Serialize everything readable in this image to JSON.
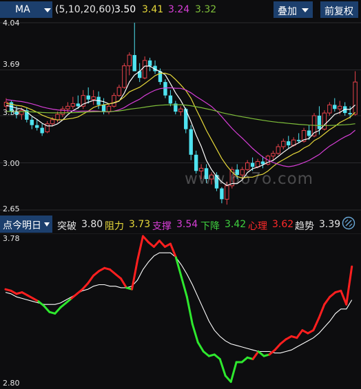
{
  "top": {
    "indicator": "MA",
    "params": "(5,10,20,60)",
    "ma5": "3.50",
    "ma10": "3.41",
    "ma20": "3.24",
    "ma60": "3.32",
    "overlay": "叠加",
    "adjust": "前复权"
  },
  "main_axis": {
    "y1": "4.04",
    "y2": "3.69",
    "y3": "3.35",
    "y4": "3.00",
    "y5": "2.65"
  },
  "watermark": "www.6o7o.com",
  "colors": {
    "up": "#e8434b",
    "down": "#4fe3f0",
    "ma5": "#ffffff",
    "ma10": "#e6d83a",
    "ma20": "#d63ed6",
    "ma60": "#7fbf3a"
  },
  "chart_data": [
    {
      "type": "candlestick",
      "ylim": [
        2.65,
        4.04
      ],
      "ticks": [
        4.04,
        3.69,
        3.35,
        3.0,
        2.65
      ],
      "candles": [
        [
          3.42,
          3.48,
          3.38,
          3.45
        ],
        [
          3.45,
          3.46,
          3.36,
          3.38
        ],
        [
          3.38,
          3.42,
          3.33,
          3.36
        ],
        [
          3.36,
          3.41,
          3.32,
          3.39
        ],
        [
          3.39,
          3.41,
          3.3,
          3.32
        ],
        [
          3.32,
          3.34,
          3.25,
          3.28
        ],
        [
          3.28,
          3.32,
          3.24,
          3.26
        ],
        [
          3.26,
          3.29,
          3.2,
          3.22
        ],
        [
          3.23,
          3.31,
          3.22,
          3.29
        ],
        [
          3.29,
          3.34,
          3.27,
          3.32
        ],
        [
          3.32,
          3.38,
          3.3,
          3.36
        ],
        [
          3.36,
          3.42,
          3.34,
          3.4
        ],
        [
          3.4,
          3.45,
          3.37,
          3.42
        ],
        [
          3.42,
          3.49,
          3.4,
          3.44
        ],
        [
          3.44,
          3.5,
          3.4,
          3.42
        ],
        [
          3.42,
          3.54,
          3.4,
          3.5
        ],
        [
          3.5,
          3.56,
          3.44,
          3.47
        ],
        [
          3.47,
          3.54,
          3.43,
          3.49
        ],
        [
          3.49,
          3.53,
          3.4,
          3.43
        ],
        [
          3.43,
          3.48,
          3.36,
          3.38
        ],
        [
          3.38,
          3.44,
          3.36,
          3.42
        ],
        [
          3.42,
          3.52,
          3.41,
          3.5
        ],
        [
          3.5,
          3.58,
          3.49,
          3.56
        ],
        [
          3.56,
          3.74,
          3.55,
          3.72
        ],
        [
          3.72,
          3.82,
          3.65,
          3.8
        ],
        [
          3.8,
          4.04,
          3.74,
          3.68
        ],
        [
          3.68,
          3.74,
          3.6,
          3.63
        ],
        [
          3.63,
          3.79,
          3.62,
          3.76
        ],
        [
          3.76,
          3.78,
          3.68,
          3.72
        ],
        [
          3.72,
          3.76,
          3.66,
          3.68
        ],
        [
          3.68,
          3.7,
          3.58,
          3.6
        ],
        [
          3.6,
          3.62,
          3.48,
          3.5
        ],
        [
          3.5,
          3.54,
          3.42,
          3.44
        ],
        [
          3.44,
          3.46,
          3.36,
          3.38
        ],
        [
          3.38,
          3.42,
          3.35,
          3.4
        ],
        [
          3.4,
          3.41,
          3.22,
          3.25
        ],
        [
          3.25,
          3.28,
          3.02,
          3.06
        ],
        [
          3.06,
          3.09,
          2.92,
          2.94
        ],
        [
          2.94,
          2.99,
          2.88,
          2.96
        ],
        [
          2.96,
          2.99,
          2.85,
          2.88
        ],
        [
          2.88,
          2.93,
          2.84,
          2.91
        ],
        [
          2.91,
          2.93,
          2.79,
          2.81
        ],
        [
          2.81,
          2.82,
          2.7,
          2.73
        ],
        [
          2.73,
          2.86,
          2.69,
          2.83
        ],
        [
          2.83,
          2.97,
          2.81,
          2.95
        ],
        [
          2.95,
          2.99,
          2.88,
          2.91
        ],
        [
          2.91,
          2.97,
          2.88,
          2.95
        ],
        [
          2.95,
          3.02,
          2.94,
          3.0
        ],
        [
          3.0,
          3.04,
          2.94,
          2.97
        ],
        [
          2.97,
          3.03,
          2.96,
          3.01
        ],
        [
          3.01,
          3.05,
          2.96,
          2.99
        ],
        [
          2.99,
          3.06,
          2.98,
          3.05
        ],
        [
          3.05,
          3.09,
          3.02,
          3.07
        ],
        [
          3.07,
          3.14,
          3.06,
          3.12
        ],
        [
          3.12,
          3.18,
          3.1,
          3.16
        ],
        [
          3.16,
          3.2,
          3.11,
          3.13
        ],
        [
          3.13,
          3.19,
          3.12,
          3.17
        ],
        [
          3.17,
          3.22,
          3.15,
          3.16
        ],
        [
          3.16,
          3.26,
          3.15,
          3.24
        ],
        [
          3.24,
          3.28,
          3.17,
          3.2
        ],
        [
          3.2,
          3.37,
          3.19,
          3.35
        ],
        [
          3.35,
          3.42,
          3.21,
          3.25
        ],
        [
          3.25,
          3.39,
          3.24,
          3.37
        ],
        [
          3.37,
          3.45,
          3.35,
          3.43
        ],
        [
          3.43,
          3.48,
          3.38,
          3.4
        ],
        [
          3.4,
          3.46,
          3.36,
          3.42
        ],
        [
          3.42,
          3.45,
          3.35,
          3.37
        ],
        [
          3.37,
          3.42,
          3.33,
          3.36
        ],
        [
          3.36,
          3.68,
          3.35,
          3.6
        ]
      ]
    },
    {
      "type": "line",
      "ylim": [
        2.8,
        3.78
      ],
      "ticks": [
        3.78,
        2.8
      ],
      "series": [
        {
          "values": [
            3.43,
            3.42,
            3.4,
            3.41,
            3.39,
            3.37,
            3.35,
            3.32,
            3.28,
            3.27,
            3.31,
            3.34,
            3.37,
            3.4,
            3.43,
            3.47,
            3.52,
            3.55,
            3.57,
            3.56,
            3.53,
            3.5,
            3.44,
            3.43,
            3.62,
            3.78,
            3.74,
            3.71,
            3.75,
            3.71,
            3.73,
            3.64,
            3.51,
            3.38,
            3.2,
            3.08,
            3.02,
            2.99,
            3.0,
            2.97,
            2.86,
            2.82,
            2.95,
            2.95,
            2.98,
            2.97,
            3.02,
            2.99,
            3.0,
            3.03,
            3.07,
            3.1,
            3.12,
            3.11,
            3.16,
            3.14,
            3.16,
            3.24,
            3.33,
            3.38,
            3.41,
            3.42,
            3.33,
            3.58
          ]
        },
        {
          "values": [
            3.41,
            3.4,
            3.38,
            3.37,
            3.36,
            3.35,
            3.34,
            3.33,
            3.33,
            3.33,
            3.34,
            3.36,
            3.38,
            3.4,
            3.42,
            3.43,
            3.45,
            3.46,
            3.46,
            3.45,
            3.45,
            3.44,
            3.44,
            3.45,
            3.49,
            3.56,
            3.61,
            3.65,
            3.67,
            3.67,
            3.67,
            3.64,
            3.59,
            3.53,
            3.46,
            3.38,
            3.3,
            3.22,
            3.16,
            3.12,
            3.09,
            3.07,
            3.06,
            3.05,
            3.04,
            3.03,
            3.02,
            3.02,
            3.02,
            3.01,
            3.01,
            3.02,
            3.03,
            3.05,
            3.07,
            3.09,
            3.11,
            3.14,
            3.18,
            3.22,
            3.27,
            3.3,
            3.3,
            3.36
          ]
        }
      ]
    }
  ],
  "indicator_bar": {
    "selector": "点今明日",
    "k1": "突破",
    "v1": "3.80",
    "k2": "阻力",
    "v2": "3.73",
    "k3": "支撑",
    "v3": "3.54",
    "k4": "下降",
    "v4": "3.42",
    "k5": "心理",
    "v5": "3.62",
    "k6": "趋势",
    "v6": "3.39"
  },
  "sub_axis": {
    "top": "3.78",
    "bottom": "2.80"
  }
}
